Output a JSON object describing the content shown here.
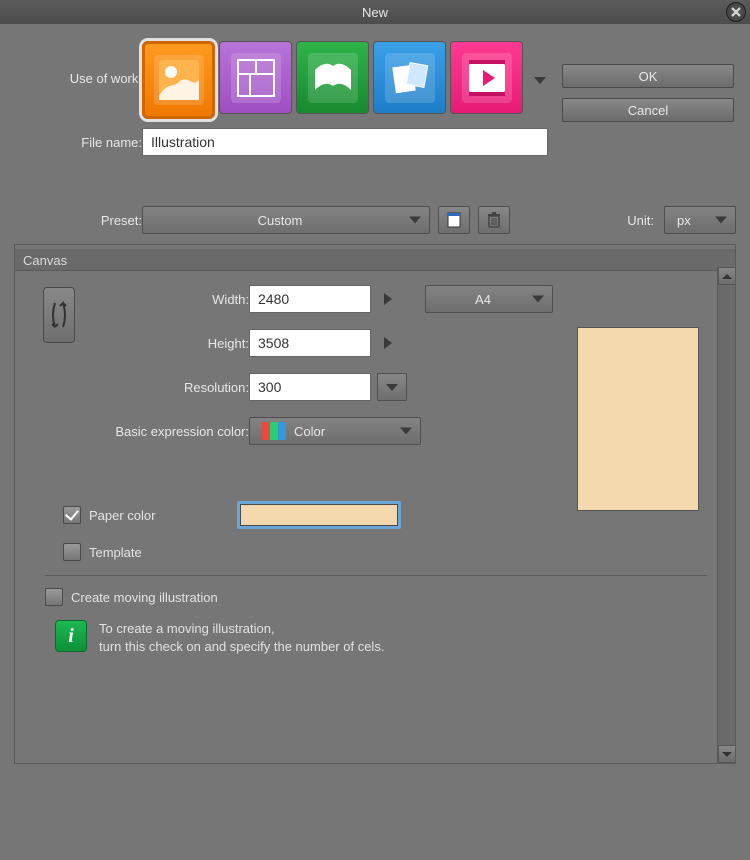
{
  "window": {
    "title": "New"
  },
  "buttons": {
    "ok": "OK",
    "cancel": "Cancel"
  },
  "labels": {
    "use_of_work": "Use of work:",
    "file_name": "File name:",
    "preset": "Preset:",
    "unit": "Unit:"
  },
  "use_tabs": [
    "illustration",
    "comic",
    "book",
    "print",
    "animation"
  ],
  "file_name_value": "Illustration",
  "preset_value": "Custom",
  "unit_value": "px",
  "canvas": {
    "group_title": "Canvas",
    "width_label": "Width:",
    "height_label": "Height:",
    "resolution_label": "Resolution:",
    "color_label": "Basic expression color:",
    "width": "2480",
    "height": "3508",
    "resolution": "300",
    "paper_preset": "A4",
    "color_mode": "Color",
    "paper_color_checked": true,
    "paper_color_label": "Paper color",
    "paper_color_value": "#f4d9af",
    "template_checked": false,
    "template_label": "Template",
    "moving_checked": false,
    "moving_label": "Create moving illustration",
    "help_line1": "To create a moving illustration,",
    "help_line2": "turn this check on and specify the number of cels."
  }
}
